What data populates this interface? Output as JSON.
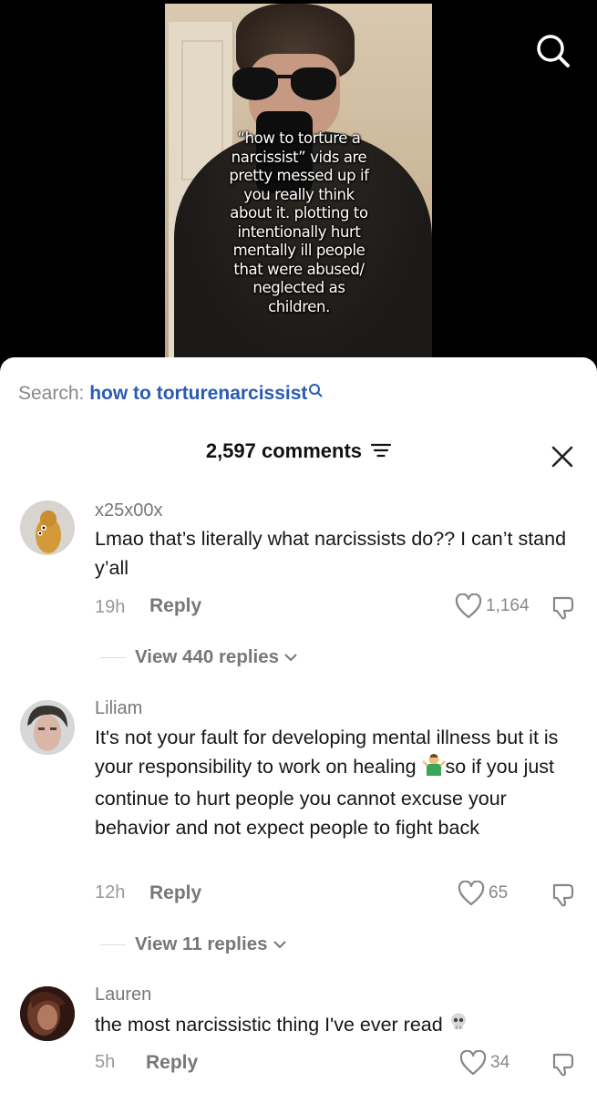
{
  "video": {
    "overlay_text": "“how to torture a\nnarcissist” vids are\npretty messed up if\nyou really think\nabout it. plotting to\nintentionally hurt\nmentally ill people\nthat were abused/\nneglected as\nchildren."
  },
  "header": {
    "search_prefix": "Search:",
    "search_query": "how to torturenarcissist",
    "comment_count": "2,597 comments"
  },
  "comments": [
    {
      "username": "x25x00x",
      "text": "Lmao that’s literally what narcissists do?? I can’t stand y’all",
      "time": "19h",
      "reply_label": "Reply",
      "likes": "1,164",
      "view_replies": "View 440 replies"
    },
    {
      "username": "Liliam",
      "text_before_emoji": "It's not your fault for developing mental illness but it is your responsibility to work on healing ",
      "emoji": "person-shrugging",
      "text_after_emoji": "so if you just continue to hurt people you cannot excuse your behavior and not expect people to fight back",
      "time": "12h",
      "reply_label": "Reply",
      "likes": "65",
      "view_replies": "View 11 replies"
    },
    {
      "username": "Lauren",
      "text": "the most narcissistic thing I've ever read ",
      "emoji": "skull",
      "time": "5h",
      "reply_label": "Reply",
      "likes": "34"
    }
  ],
  "colors": {
    "link_blue": "#2a5bb0",
    "muted_gray": "#777777"
  }
}
